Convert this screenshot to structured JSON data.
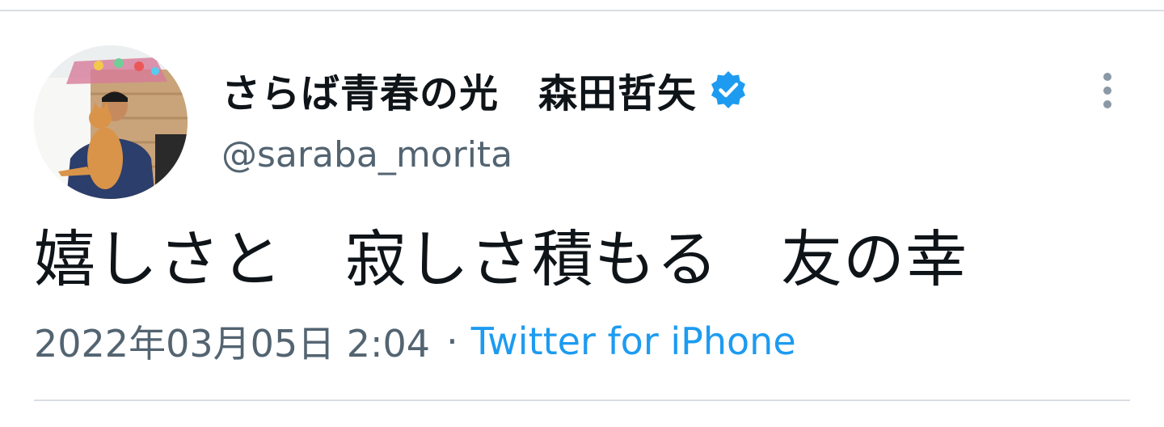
{
  "tweet": {
    "author": {
      "display_name": "さらば青春の光　森田哲矢",
      "handle": "@saraba_morita",
      "verified": true,
      "verified_color": "#1d9bf0"
    },
    "text": "嬉しさと　寂しさ積もる　友の幸",
    "timestamp": "2022年03月05日 2:04",
    "separator": "·",
    "source": "Twitter for iPhone"
  },
  "icons": {
    "verified": "verified-badge-icon",
    "more": "more-options-icon"
  },
  "colors": {
    "text_primary": "#0f1419",
    "text_secondary": "#536471",
    "link": "#1d9bf0",
    "divider": "#d8dee3"
  }
}
